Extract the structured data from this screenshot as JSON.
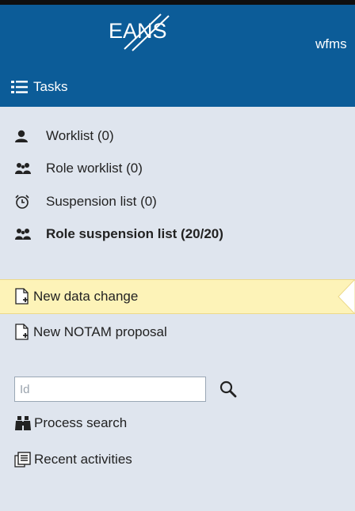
{
  "header": {
    "logo_text": "EANS",
    "user": "wfms",
    "tasks_label": "Tasks",
    "tasks_icon": "list-icon",
    "background": "#0c5c98"
  },
  "worklists": [
    {
      "icon": "person-icon",
      "label": "Worklist  (0)",
      "bold": false
    },
    {
      "icon": "group-icon",
      "label": "Role worklist  (0)",
      "bold": false
    },
    {
      "icon": "alarm-clock-icon",
      "label": "Suspension list  (0)",
      "bold": false
    },
    {
      "icon": "group-icon",
      "label": "Role suspension list  (20/20)",
      "bold": true
    }
  ],
  "actions": [
    {
      "icon": "new-document-icon",
      "label": "New data change",
      "active": true
    },
    {
      "icon": "new-document-icon",
      "label": "New NOTAM proposal",
      "active": false
    }
  ],
  "search": {
    "placeholder": "Id",
    "value": "",
    "icon": "search-icon"
  },
  "links": [
    {
      "icon": "binoculars-icon",
      "label": "Process search"
    },
    {
      "icon": "documents-icon",
      "label": "Recent activities"
    }
  ],
  "colors": {
    "sidebar_bg": "#dfe5ee",
    "active_bg": "#fdf3b8"
  }
}
